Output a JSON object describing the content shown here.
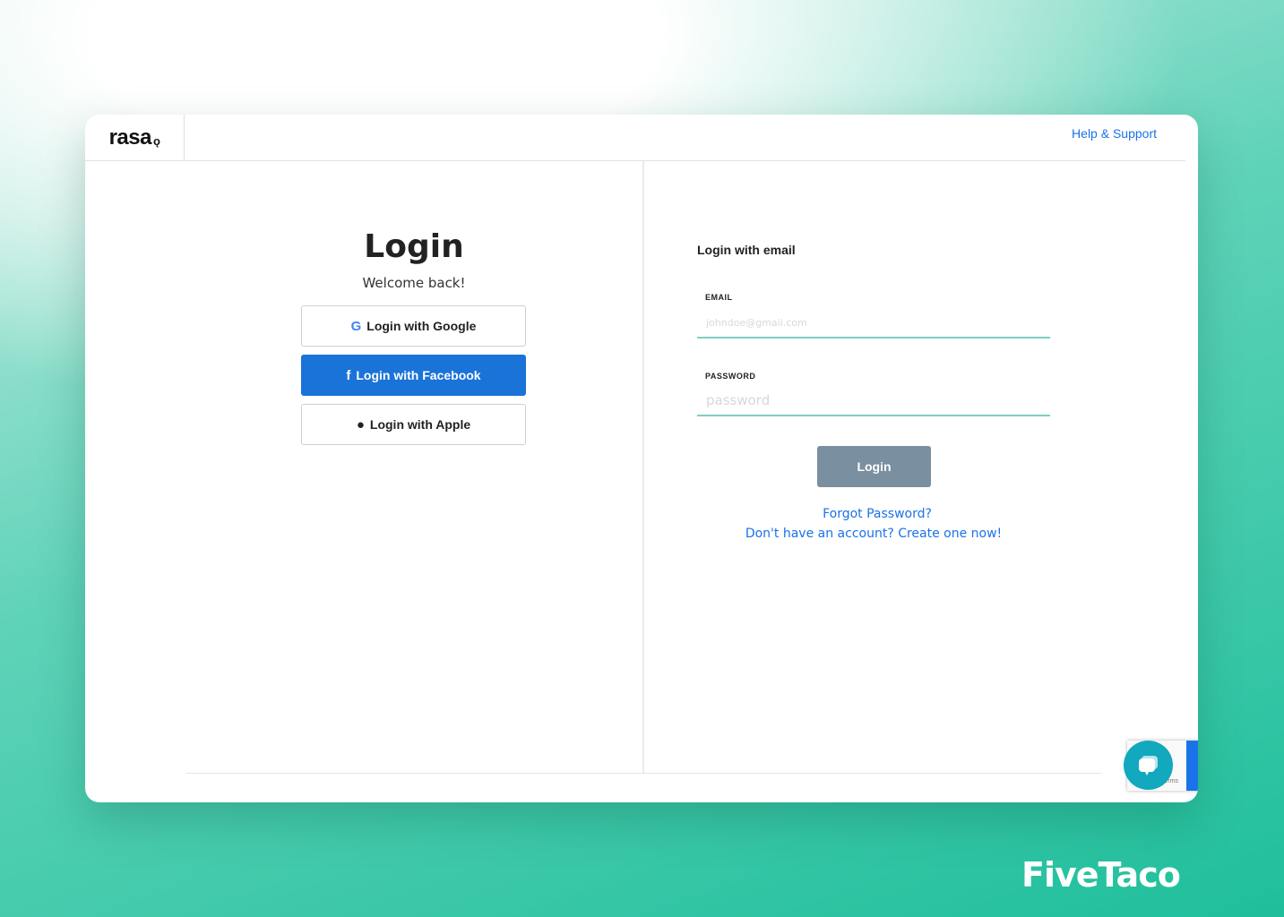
{
  "header": {
    "logo": "rasa",
    "help_link": "Help & Support"
  },
  "left": {
    "title": "Login",
    "subtitle": "Welcome back!",
    "google": "Login with Google",
    "facebook": "Login with Facebook",
    "apple": "Login with Apple"
  },
  "right": {
    "heading": "Login with email",
    "email_label": "EMAIL",
    "email_placeholder": "johndoe@gmail.com",
    "email_value": "",
    "password_label": "PASSWORD",
    "password_placeholder": "password",
    "password_value": "",
    "login_button": "Login",
    "forgot": "Forgot Password?",
    "signup": "Don't have an account? Create one now!"
  },
  "recaptcha": {
    "text": "Terms"
  },
  "watermark": "FiveTaco",
  "colors": {
    "accent": "#1a73e8",
    "facebook": "#1a73d8",
    "input_underline": "#7ccfc2",
    "login_button": "#7a8fa0",
    "chat": "#12a8bd"
  }
}
